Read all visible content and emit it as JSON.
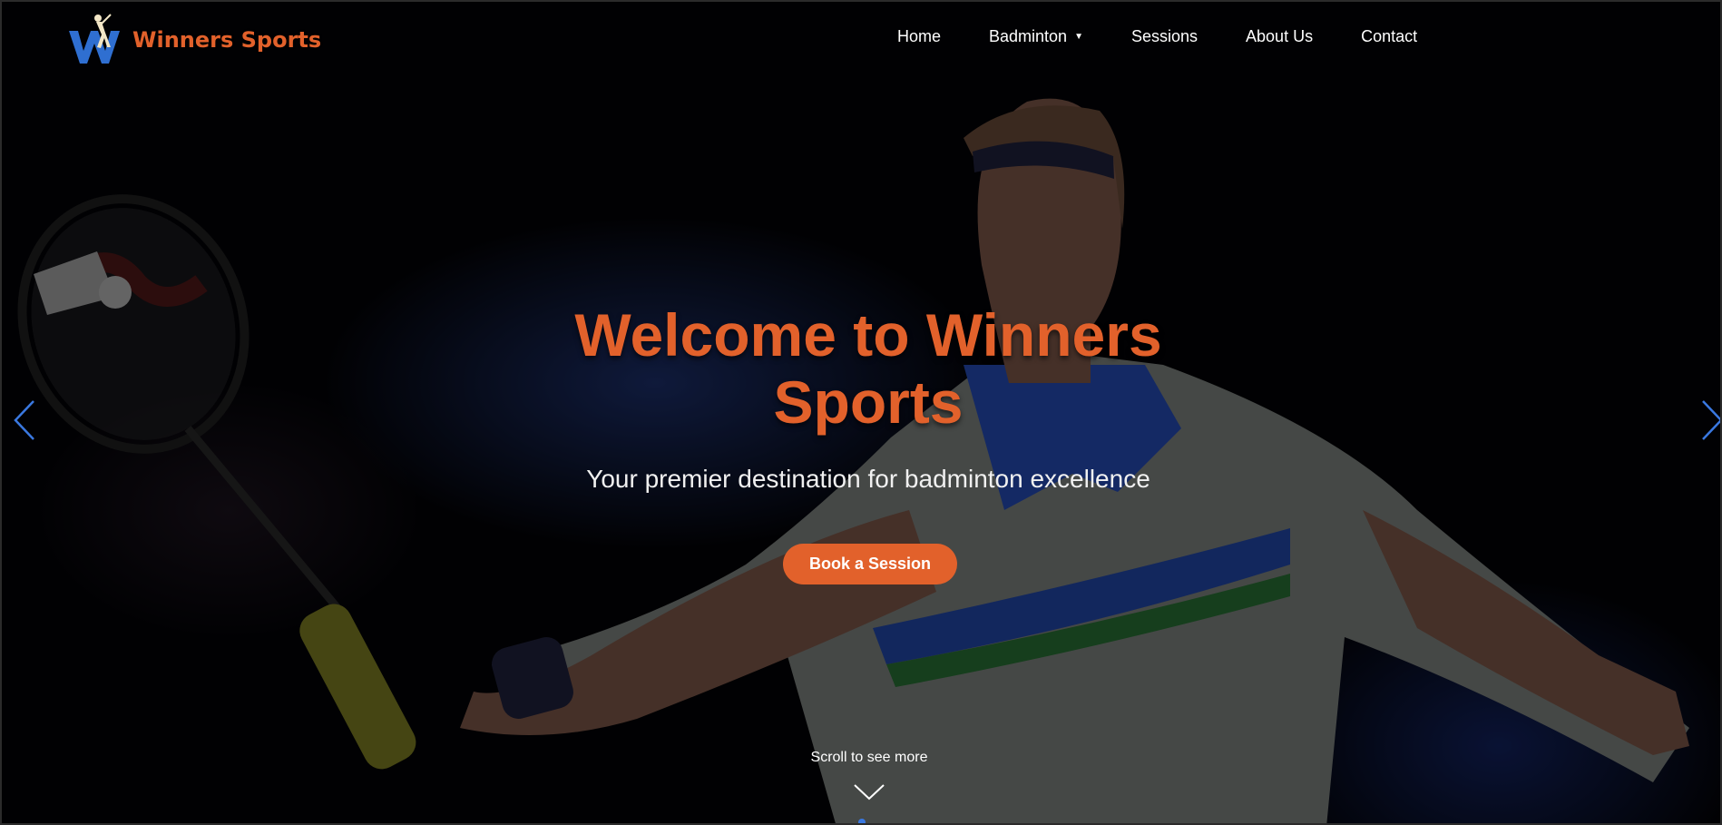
{
  "brand": {
    "name": "Winners Sports",
    "logo_icon": "badminton-player-w-logo-icon",
    "accent_color": "#e2612b"
  },
  "nav": {
    "items": [
      {
        "label": "Home"
      },
      {
        "label": "Badminton",
        "dropdown_icon": "caret-down-icon"
      },
      {
        "label": "Sessions"
      },
      {
        "label": "About Us"
      },
      {
        "label": "Contact"
      }
    ]
  },
  "hero": {
    "title": "Welcome to Winners Sports",
    "subtitle": "Your premier destination for badminton excellence",
    "cta_label": "Book a Session",
    "prev_icon": "chevron-left-icon",
    "next_icon": "chevron-right-icon",
    "arrow_color": "#3a78e0"
  },
  "scroll": {
    "hint": "Scroll to see more",
    "icon": "chevron-down-icon"
  }
}
